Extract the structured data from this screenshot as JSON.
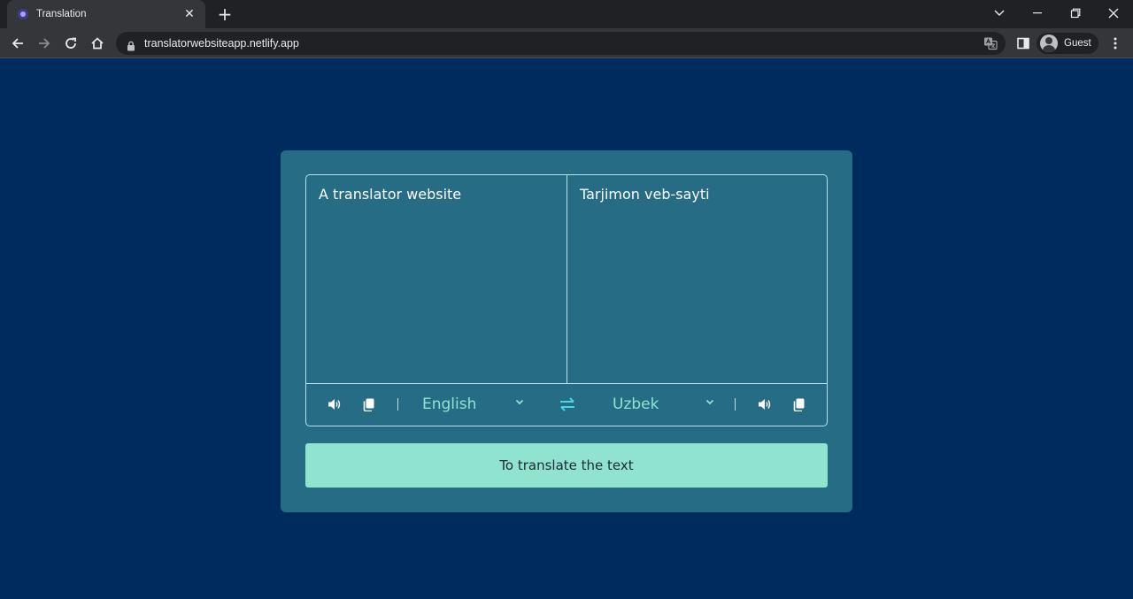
{
  "browser": {
    "tab": {
      "title": "Translation"
    },
    "address_bar": {
      "url": "translatorwebsiteapp.netlify.app"
    },
    "profile": {
      "label": "Guest"
    }
  },
  "translator": {
    "from_text": "A translator website",
    "to_text": "Tarjimon veb-sayti",
    "from_language": "English",
    "to_language": "Uzbek",
    "translate_button": "To translate the text"
  },
  "colors": {
    "page_background": "#002b5f",
    "card_background": "#266c85",
    "accent": "#8fe3cf"
  }
}
